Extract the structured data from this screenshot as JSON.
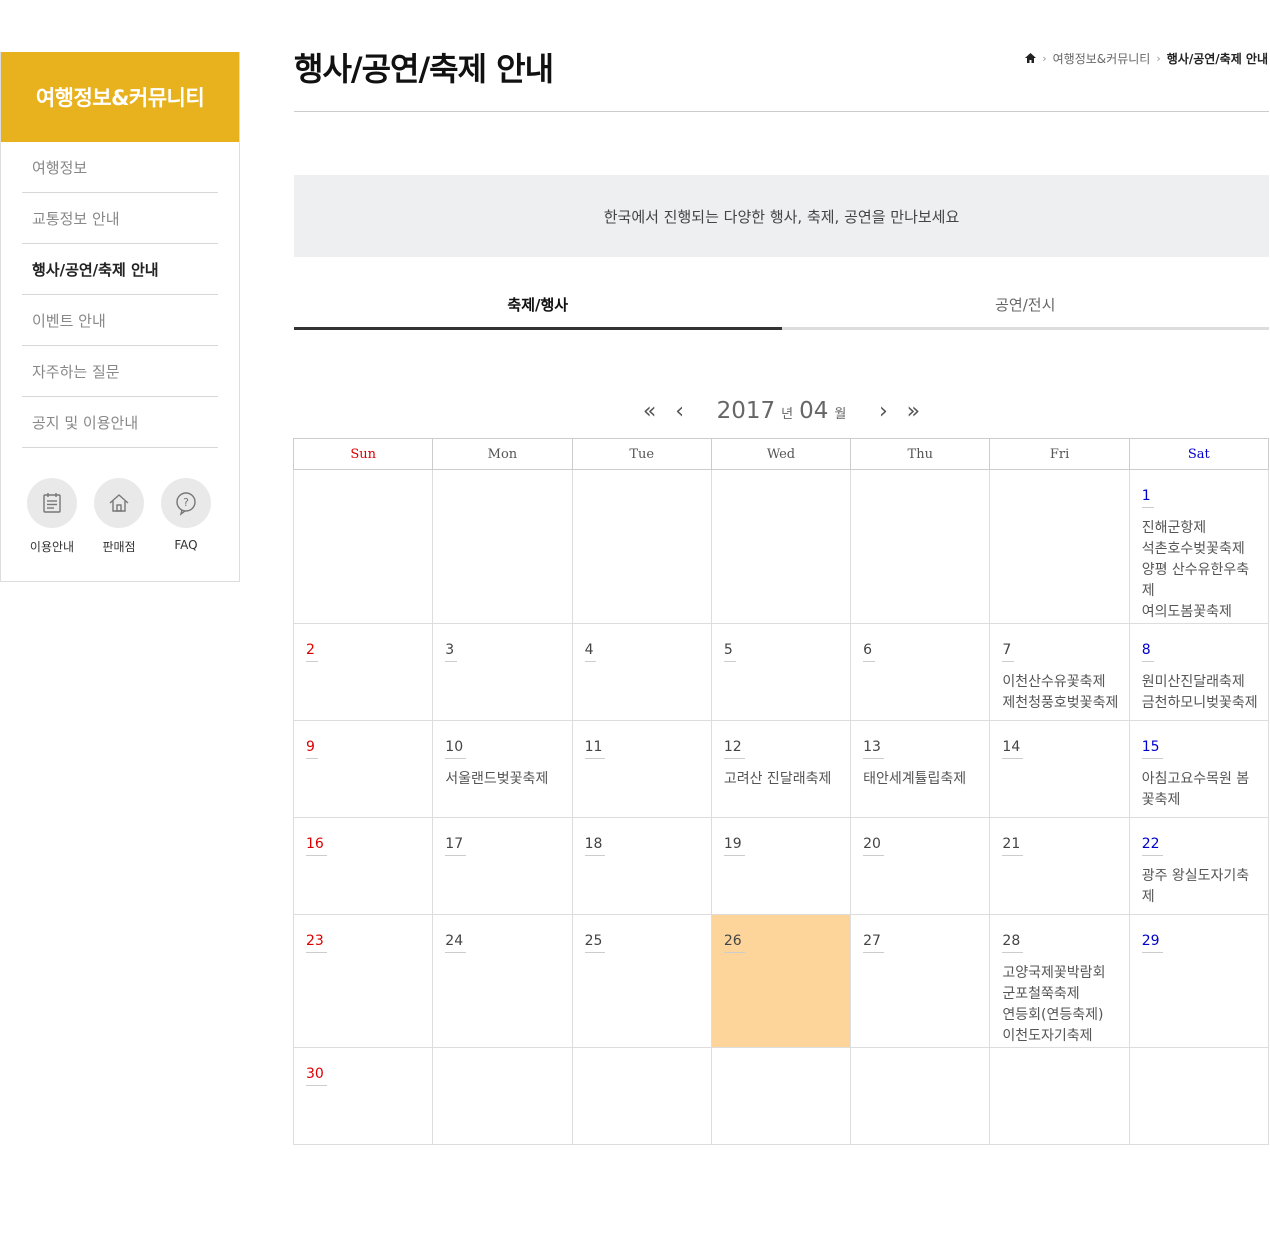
{
  "sidebar": {
    "title": "여행정보&커뮤니티",
    "items": [
      {
        "label": "여행정보"
      },
      {
        "label": "교통정보 안내"
      },
      {
        "label": "행사/공연/축제 안내"
      },
      {
        "label": "이벤트 안내"
      },
      {
        "label": "자주하는 질문"
      },
      {
        "label": "공지 및 이용안내"
      }
    ],
    "active_index": 2,
    "quick_links": [
      {
        "label": "이용안내",
        "icon": "calendar-list-icon"
      },
      {
        "label": "판매점",
        "icon": "home-icon"
      },
      {
        "label": "FAQ",
        "icon": "question-bubble-icon"
      }
    ]
  },
  "page": {
    "title": "행사/공연/축제 안내",
    "breadcrumb": [
      "여행정보&커뮤니티",
      "행사/공연/축제 안내"
    ],
    "banner": "한국에서 진행되는 다양한 행사, 축제, 공연을 만나보세요",
    "tabs": [
      "축제/행사",
      "공연/전시"
    ]
  },
  "calendar": {
    "year": "2017",
    "year_unit": "년",
    "month": "04",
    "month_unit": "월",
    "nav": {
      "prev_year": "«",
      "prev_month": "‹",
      "next_month": "›",
      "next_year": "»"
    },
    "weekdays": [
      "Sun",
      "Mon",
      "Tue",
      "Wed",
      "Thu",
      "Fri",
      "Sat"
    ],
    "today": "26",
    "weeks": [
      [
        null,
        null,
        null,
        null,
        null,
        null,
        {
          "day": "1",
          "events": [
            "진해군항제",
            "석촌호수벚꽃축제",
            "양평 산수유한우축제",
            "여의도봄꽃축제"
          ]
        }
      ],
      [
        {
          "day": "2",
          "events": []
        },
        {
          "day": "3",
          "events": []
        },
        {
          "day": "4",
          "events": []
        },
        {
          "day": "5",
          "events": []
        },
        {
          "day": "6",
          "events": []
        },
        {
          "day": "7",
          "events": [
            "이천산수유꽃축제",
            "제천청풍호벚꽃축제"
          ]
        },
        {
          "day": "8",
          "events": [
            "원미산진달래축제",
            "금천하모니벚꽃축제"
          ]
        }
      ],
      [
        {
          "day": "9",
          "events": []
        },
        {
          "day": "10",
          "events": [
            "서울랜드벚꽃축제"
          ]
        },
        {
          "day": "11",
          "events": []
        },
        {
          "day": "12",
          "events": [
            "고려산 진달래축제"
          ]
        },
        {
          "day": "13",
          "events": [
            "태안세계튤립축제"
          ]
        },
        {
          "day": "14",
          "events": []
        },
        {
          "day": "15",
          "events": [
            "아침고요수목원 봄꽃축제"
          ]
        }
      ],
      [
        {
          "day": "16",
          "events": []
        },
        {
          "day": "17",
          "events": []
        },
        {
          "day": "18",
          "events": []
        },
        {
          "day": "19",
          "events": []
        },
        {
          "day": "20",
          "events": []
        },
        {
          "day": "21",
          "events": []
        },
        {
          "day": "22",
          "events": [
            "광주 왕실도자기축제"
          ]
        }
      ],
      [
        {
          "day": "23",
          "events": []
        },
        {
          "day": "24",
          "events": []
        },
        {
          "day": "25",
          "events": []
        },
        {
          "day": "26",
          "events": []
        },
        {
          "day": "27",
          "events": []
        },
        {
          "day": "28",
          "events": [
            "고양국제꽃박람회",
            "군포철쭉축제",
            "연등회(연등축제)",
            "이천도자기축제"
          ]
        },
        {
          "day": "29",
          "events": []
        }
      ],
      [
        {
          "day": "30",
          "events": []
        },
        null,
        null,
        null,
        null,
        null,
        null
      ]
    ]
  }
}
